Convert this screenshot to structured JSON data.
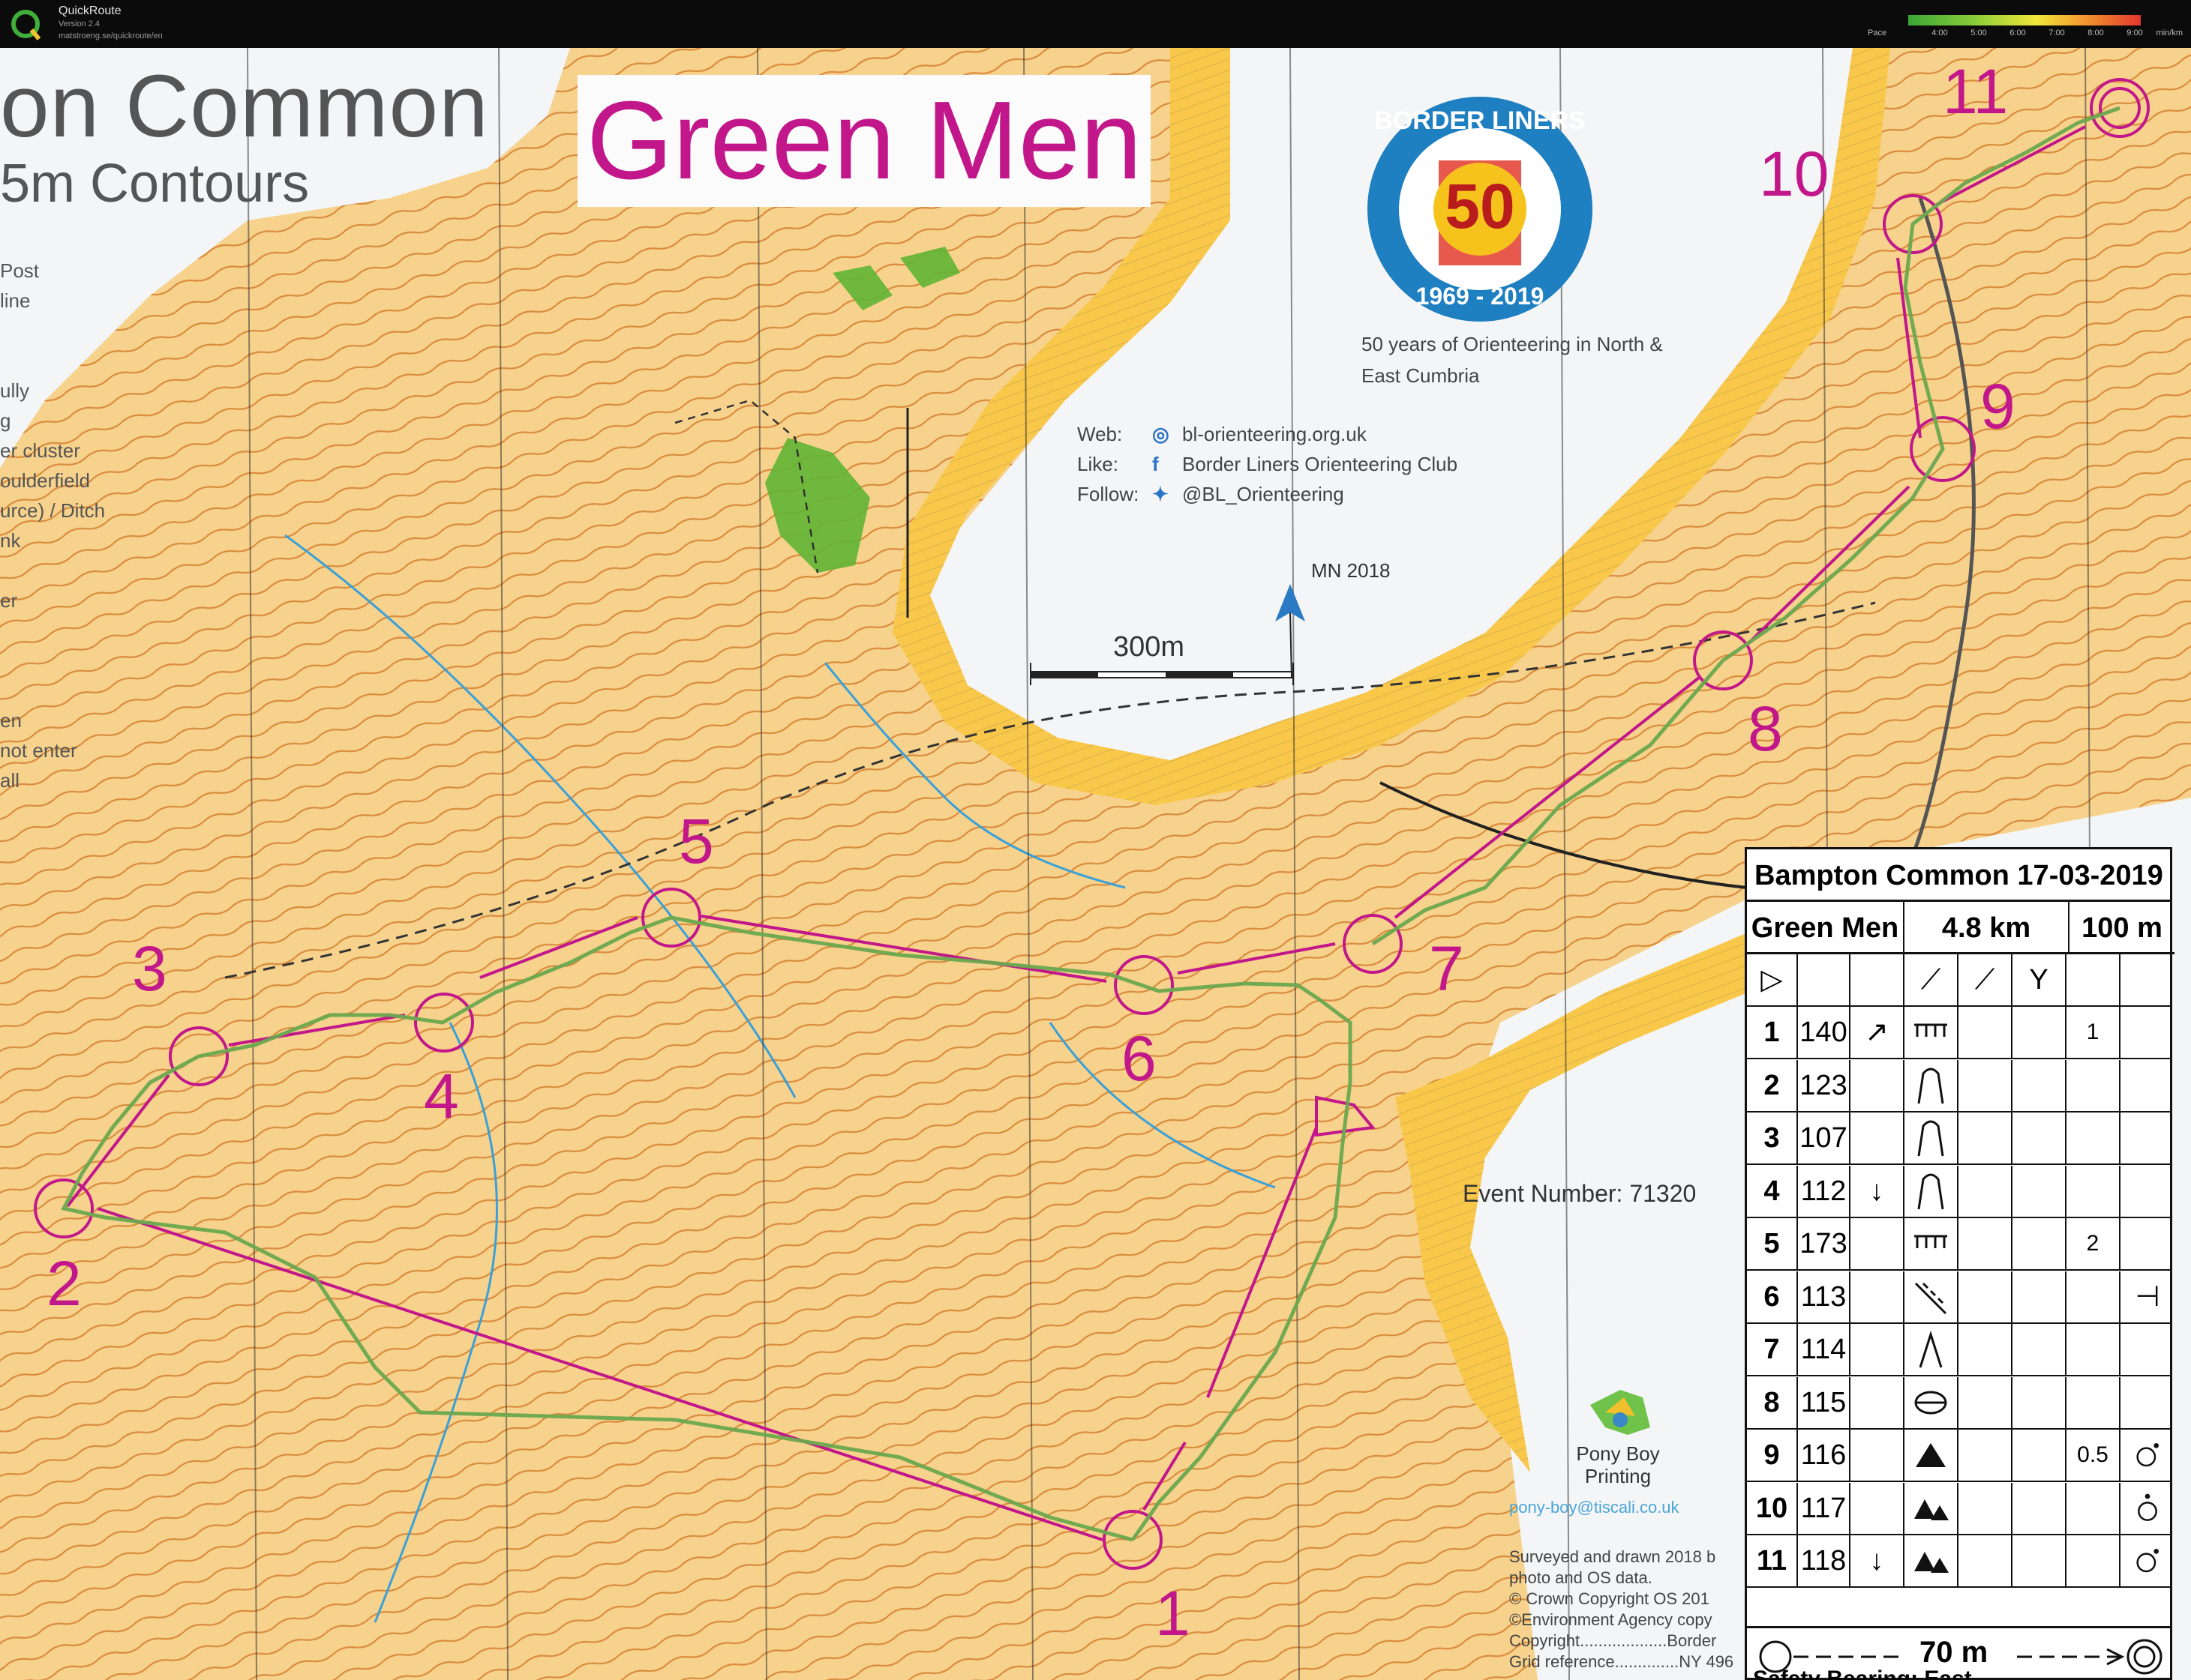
{
  "app": {
    "name": "QuickRoute",
    "version": "Version 2.4",
    "url": "matstroeng.se/quickroute/en"
  },
  "pace_legend": {
    "label": "Pace",
    "unit": "min/km",
    "ticks": [
      "4:00",
      "5:00",
      "6:00",
      "7:00",
      "8:00",
      "9:00"
    ]
  },
  "map": {
    "title_fragment": "on Common",
    "subtitle_fragment": "5m Contours",
    "course_banner": "Green Men",
    "legend_fragments": [
      "Post",
      "line",
      "ully",
      "g",
      "er cluster",
      "oulderfield",
      "urce) / Ditch",
      "nk",
      "er",
      "en",
      "not enter",
      "all"
    ],
    "logo": {
      "top_text": "BORDER LINERS",
      "badge": "50",
      "years": "1969 - 2019"
    },
    "tagline": "50 years of Orienteering in North & East Cumbria",
    "web_rows": [
      {
        "label": "Web:",
        "icon": "globe-icon",
        "value": "bl-orienteering.org.uk"
      },
      {
        "label": "Like:",
        "icon": "facebook-icon",
        "value": "Border Liners Orienteering Club"
      },
      {
        "label": "Follow:",
        "icon": "twitter-icon",
        "value": "@BL_Orienteering"
      }
    ],
    "north_label": "MN 2018",
    "scale_bar": "300m",
    "event_number": "Event Number: 71320",
    "printer": {
      "name": "Pony Boy Printing",
      "email": "pony-boy@tiscali.co.uk"
    },
    "survey_lines": [
      "Surveyed and drawn 2018 b",
      "photo and OS data.",
      "© Crown Copyright OS 201",
      "©Environment Agency copy",
      "Copyright...................Border",
      "Grid reference..............NY 496"
    ],
    "control_numbers": [
      "1",
      "2",
      "3",
      "4",
      "5",
      "6",
      "7",
      "8",
      "9",
      "10",
      "11"
    ],
    "colors": {
      "course": "#c2178a",
      "map_background": "#f7d28c",
      "open_land": "#f9c84a",
      "contour": "#d27a2a",
      "route": "#6aa84f"
    }
  },
  "control_card": {
    "event": "Bampton Common 17-03-2019",
    "course": "Green Men",
    "length": "4.8 km",
    "climb": "100 m",
    "rows": [
      {
        "n": "1",
        "code": "140",
        "c": "↗",
        "feature": "terrace",
        "dim": "1",
        "h": ""
      },
      {
        "n": "2",
        "code": "123",
        "c": "",
        "feature": "spur",
        "dim": "",
        "h": ""
      },
      {
        "n": "3",
        "code": "107",
        "c": "",
        "feature": "spur",
        "dim": "",
        "h": ""
      },
      {
        "n": "4",
        "code": "112",
        "c": "↓",
        "feature": "spur",
        "dim": "",
        "h": ""
      },
      {
        "n": "5",
        "code": "173",
        "c": "",
        "feature": "terrace",
        "dim": "2",
        "h": ""
      },
      {
        "n": "6",
        "code": "113",
        "c": "",
        "feature": "ditch",
        "dim": "",
        "h": "⊣"
      },
      {
        "n": "7",
        "code": "114",
        "c": "",
        "feature": "reentrant",
        "dim": "",
        "h": ""
      },
      {
        "n": "8",
        "code": "115",
        "c": "",
        "feature": "depression",
        "dim": "",
        "h": ""
      },
      {
        "n": "9",
        "code": "116",
        "c": "",
        "feature": "boulder",
        "dim": "0.5",
        "h": "o-foot"
      },
      {
        "n": "10",
        "code": "117",
        "c": "",
        "feature": "boulders",
        "dim": "",
        "h": "o-top"
      },
      {
        "n": "11",
        "code": "118",
        "c": "↓",
        "feature": "boulders",
        "dim": "",
        "h": "o-foot"
      }
    ],
    "finish": "70 m",
    "safety": "Safety Bearing: East"
  }
}
